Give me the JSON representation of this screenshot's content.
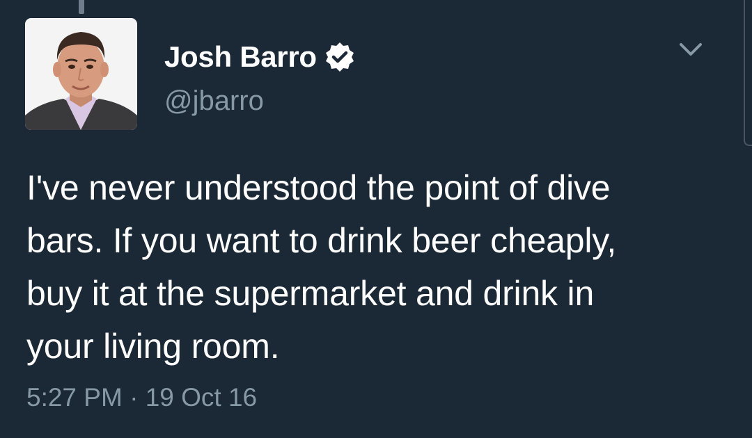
{
  "tweet": {
    "author": {
      "display_name": "Josh Barro",
      "handle": "@jbarro",
      "verified": true,
      "avatar_icon": "profile-photo"
    },
    "text_lines": [
      "I've never understood the point of dive",
      "bars. If you want to drink beer cheaply,",
      "buy it at the supermarket and drink in",
      "your living room."
    ],
    "time": "5:27 PM",
    "separator": "·",
    "date": "19 Oct 16",
    "menu_icon": "chevron-down-icon"
  },
  "colors": {
    "background": "#1b2836",
    "text": "#ffffff",
    "secondary_text": "#8899a6",
    "verified_badge": "#ffffff"
  }
}
